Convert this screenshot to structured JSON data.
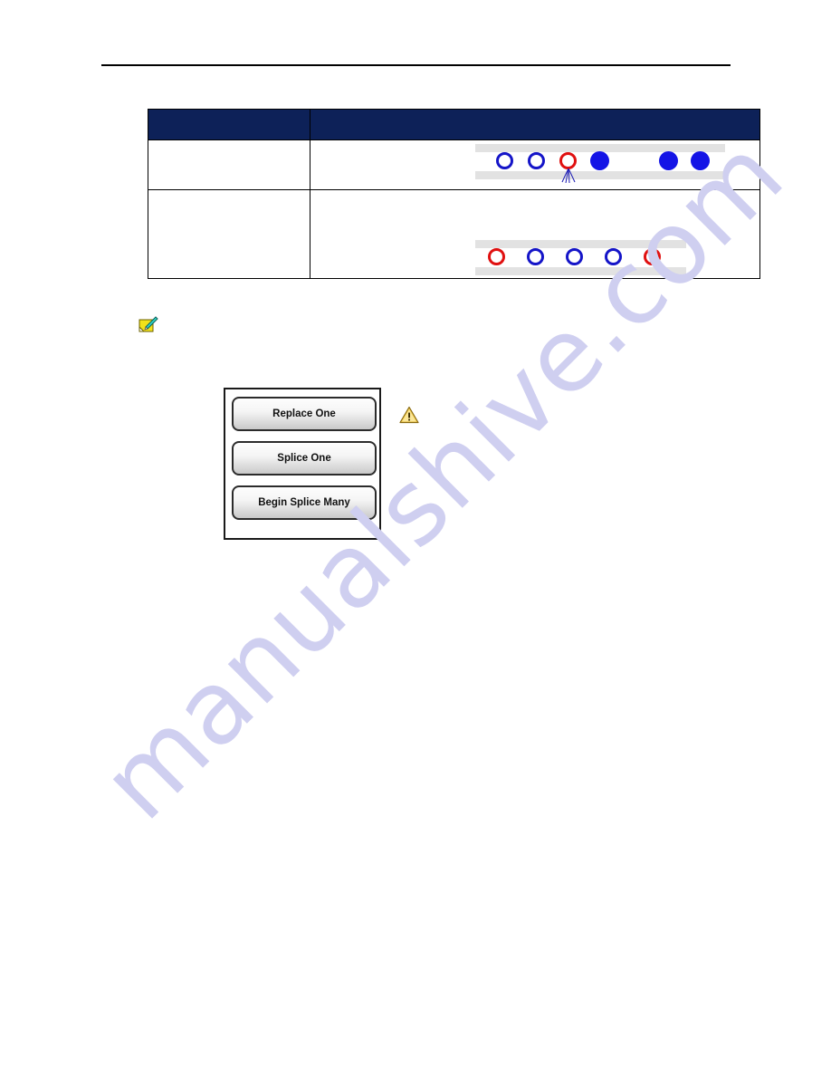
{
  "page": {
    "background_color": "#ffffff",
    "rule_color": "#000000"
  },
  "watermark": {
    "text": "manualshive.com",
    "color": "#cfcff0"
  },
  "table": {
    "header_background": "#0d2158",
    "border_color": "#000000",
    "columns": [
      {
        "header": ""
      },
      {
        "header": ""
      }
    ],
    "rows": [
      {
        "label": "",
        "description": "",
        "graphic": {
          "name": "splice-one-strip",
          "band_color": "#e2e2e2",
          "items": [
            {
              "style": "hollow",
              "color": "#1414c8",
              "marker": "none"
            },
            {
              "style": "hollow",
              "color": "#1414c8",
              "marker": "none"
            },
            {
              "style": "hollow",
              "color": "#e01010",
              "marker": "pointer-fan"
            },
            {
              "style": "filled",
              "color": "#1414e6",
              "marker": "none"
            },
            {
              "style": "gap",
              "color": "",
              "marker": "none"
            },
            {
              "style": "filled",
              "color": "#1414e6",
              "marker": "none"
            },
            {
              "style": "filled",
              "color": "#1414e6",
              "marker": "none"
            }
          ]
        }
      },
      {
        "label": "",
        "description": "",
        "graphic": {
          "name": "splice-many-strip",
          "band_color": "#e2e2e2",
          "items": [
            {
              "style": "hollow",
              "color": "#e01010",
              "marker": "none"
            },
            {
              "style": "hollow",
              "color": "#1414c8",
              "marker": "none"
            },
            {
              "style": "hollow",
              "color": "#1414c8",
              "marker": "none"
            },
            {
              "style": "hollow",
              "color": "#1414c8",
              "marker": "none"
            },
            {
              "style": "hollow",
              "color": "#e01010",
              "marker": "none"
            }
          ]
        }
      }
    ]
  },
  "note": {
    "icon": "note-pen-icon",
    "text": ""
  },
  "button_panel": {
    "buttons": [
      {
        "label": "Replace One"
      },
      {
        "label": "Splice One"
      },
      {
        "label": "Begin Splice Many"
      }
    ]
  },
  "warning": {
    "icon": "warning-triangle-icon",
    "color": "#f5c518",
    "text": ""
  }
}
